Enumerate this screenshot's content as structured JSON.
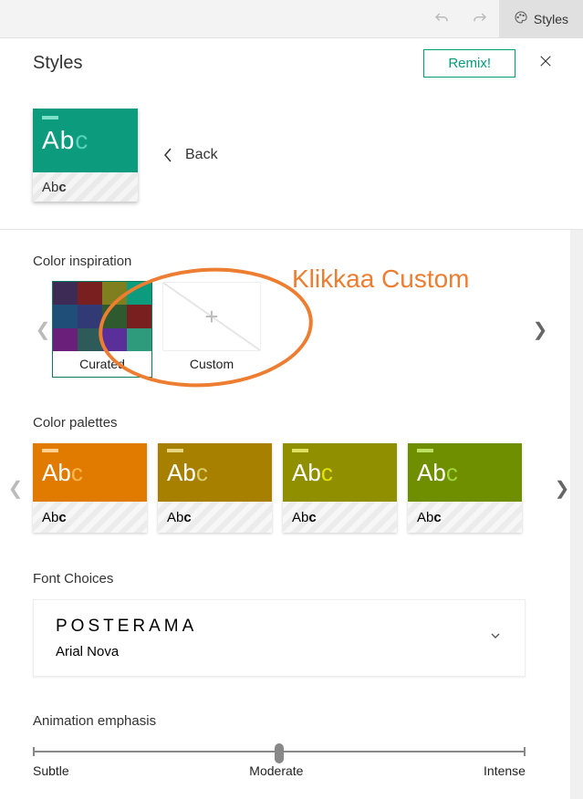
{
  "topbar": {
    "undo_icon": "undo-icon",
    "redo_icon": "redo-icon",
    "styles_tab_label": "Styles",
    "palette_icon": "palette-icon"
  },
  "header": {
    "title": "Styles",
    "remix_label": "Remix!",
    "close_icon": "close-icon"
  },
  "preview_swatch": {
    "bg": "#0d9b7d",
    "bar": "#7de0c9",
    "abc_html": "Abc",
    "a_color": "#ffffff",
    "b_color": "#ffffff",
    "c_color": "#58d3b9",
    "footer_text": "Abc"
  },
  "back_label": "Back",
  "color_inspiration": {
    "title": "Color inspiration",
    "items": [
      {
        "id": "curated",
        "label": "Curated",
        "selected": true,
        "grid": [
          "#3d2b56",
          "#7a1f1f",
          "#7f7f1f",
          "#0d9b7d",
          "#1f4e79",
          "#313a75",
          "#2f5a2f",
          "#7a1f1f",
          "#6a1f7a",
          "#2f5a5a",
          "#5a2f99",
          "#2f9b7d"
        ]
      },
      {
        "id": "custom",
        "label": "Custom",
        "selected": false,
        "is_add": true
      }
    ]
  },
  "annotation": {
    "text": "Klikkaa Custom"
  },
  "color_palettes": {
    "title": "Color palettes",
    "items": [
      {
        "bg": "#e07b00",
        "bar": "#ffcf8f",
        "a": "#fff",
        "b": "#fff",
        "c": "#ffb84d"
      },
      {
        "bg": "#a88000",
        "bar": "#e6d77f",
        "a": "#fff",
        "b": "#fff",
        "c": "#d9cf6b"
      },
      {
        "bg": "#8f8f00",
        "bar": "#e0e060",
        "a": "#fff",
        "b": "#fff",
        "c": "#e3e300"
      },
      {
        "bg": "#6f8f00",
        "bar": "#bde060",
        "a": "#fff",
        "b": "#fff",
        "c": "#a0d93b"
      }
    ],
    "footer_text": "Abc"
  },
  "font_choices": {
    "title": "Font Choices",
    "primary": "POSTERAMA",
    "secondary": "Arial Nova"
  },
  "animation": {
    "title": "Animation emphasis",
    "labels": [
      "Subtle",
      "Moderate",
      "Intense"
    ],
    "value": "Moderate"
  }
}
